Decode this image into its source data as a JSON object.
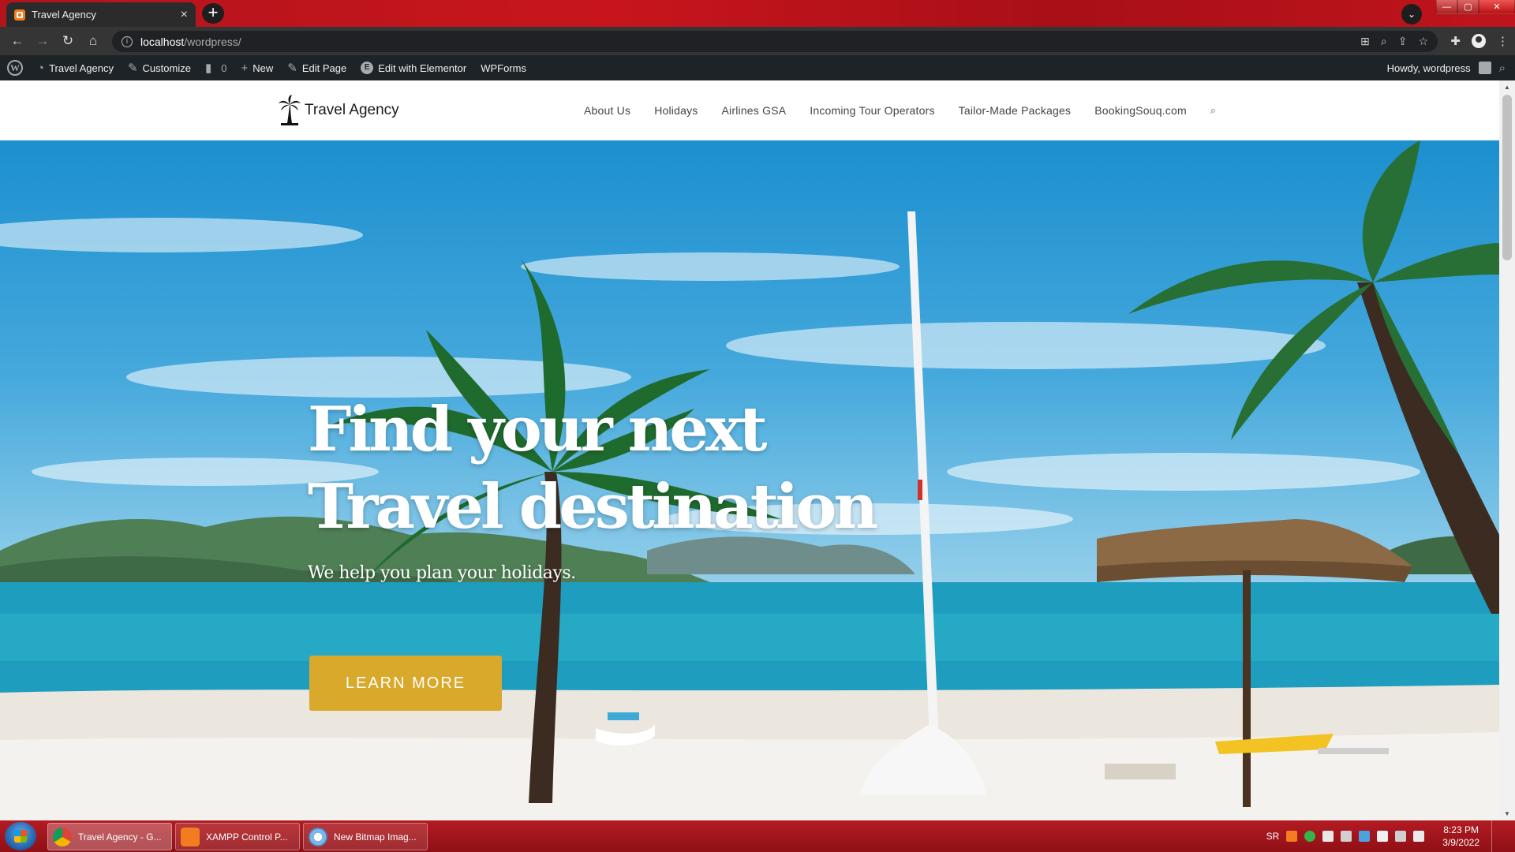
{
  "browser": {
    "tab_title": "Travel Agency",
    "tab_close": "×",
    "new_tab": "+",
    "tab_search": "⌄",
    "url_host": "localhost",
    "url_path": "/wordpress/",
    "window_controls": {
      "minimize": "—",
      "maximize": "▢",
      "close": "✕"
    }
  },
  "wp_admin_bar": {
    "site_name": "Travel Agency",
    "customize": "Customize",
    "comments_count": "0",
    "new": "New",
    "edit_page": "Edit Page",
    "edit_elementor": "Edit with Elementor",
    "wpforms": "WPForms",
    "howdy": "Howdy, wordpress"
  },
  "site": {
    "logo_text": "Travel Agency",
    "nav": [
      "About Us",
      "Holidays",
      "Airlines GSA",
      "Incoming Tour Operators",
      "Tailor-Made Packages",
      "BookingSouq.com"
    ]
  },
  "hero": {
    "title_line1": "Find your next",
    "title_line2": "Travel destination",
    "subtitle": "We help you plan your holidays.",
    "button": "LEARN MORE"
  },
  "taskbar": {
    "tasks": [
      "Travel Agency - G...",
      "XAMPP Control P...",
      "New Bitmap Imag..."
    ],
    "language": "SR",
    "time": "8:23 PM",
    "date": "3/9/2022"
  },
  "colors": {
    "accent_button": "#d9a92c",
    "wp_bar": "#1d2327",
    "chrome_frame": "#c8151d",
    "taskbar": "#a0141b"
  }
}
